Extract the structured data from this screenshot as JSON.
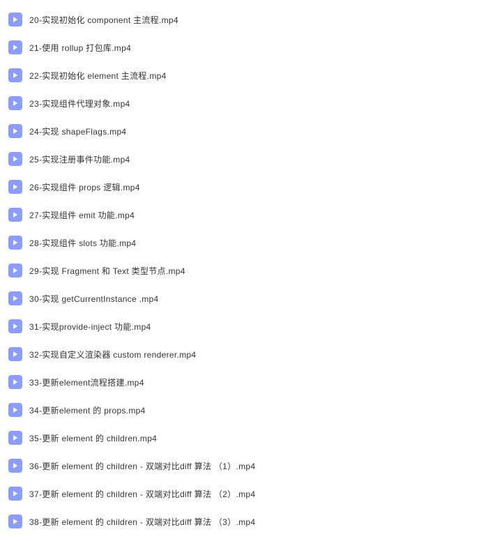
{
  "files": [
    {
      "name": "20-实现初始化 component 主流程.mp4"
    },
    {
      "name": "21-使用 rollup 打包库.mp4"
    },
    {
      "name": "22-实现初始化 element 主流程.mp4"
    },
    {
      "name": "23-实现组件代理对象.mp4"
    },
    {
      "name": "24-实现 shapeFlags.mp4"
    },
    {
      "name": "25-实现注册事件功能.mp4"
    },
    {
      "name": "26-实现组件 props 逻辑.mp4"
    },
    {
      "name": "27-实现组件 emit 功能.mp4"
    },
    {
      "name": "28-实现组件 slots 功能.mp4"
    },
    {
      "name": "29-实现 Fragment 和 Text 类型节点.mp4"
    },
    {
      "name": "30-实现 getCurrentInstance .mp4"
    },
    {
      "name": "31-实现provide-inject 功能.mp4"
    },
    {
      "name": "32-实现自定义渲染器 custom renderer.mp4"
    },
    {
      "name": "33-更新element流程搭建.mp4"
    },
    {
      "name": "34-更新element 的 props.mp4"
    },
    {
      "name": "35-更新 element 的 children.mp4"
    },
    {
      "name": "36-更新 element 的 children - 双端对比diff 算法 （1）.mp4"
    },
    {
      "name": "37-更新 element 的 children - 双端对比diff 算法 （2）.mp4"
    },
    {
      "name": "38-更新 element 的 children - 双端对比diff 算法 （3）.mp4"
    }
  ]
}
